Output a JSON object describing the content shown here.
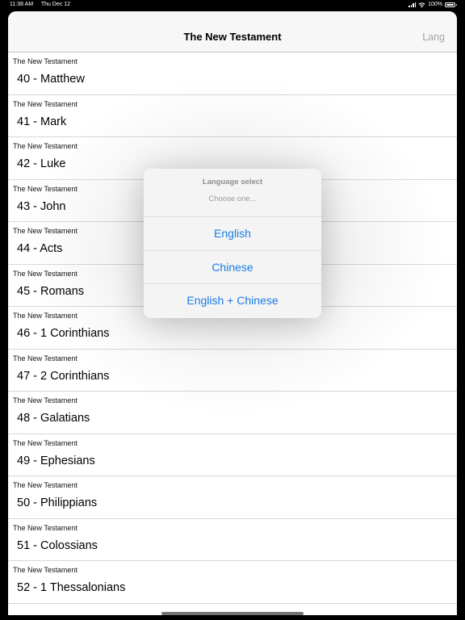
{
  "status_bar": {
    "time": "11:38 AM",
    "date": "Thu Dec 12",
    "battery_percent": "100%",
    "battery_level": 1.0
  },
  "nav": {
    "title": "The New Testament",
    "lang_button": "Lang"
  },
  "books": [
    {
      "subtitle": "The New Testament",
      "title": "40 - Matthew"
    },
    {
      "subtitle": "The New Testament",
      "title": "41 - Mark"
    },
    {
      "subtitle": "The New Testament",
      "title": "42 - Luke"
    },
    {
      "subtitle": "The New Testament",
      "title": "43 - John"
    },
    {
      "subtitle": "The New Testament",
      "title": "44 - Acts"
    },
    {
      "subtitle": "The New Testament",
      "title": "45 - Romans"
    },
    {
      "subtitle": "The New Testament",
      "title": "46 - 1 Corinthians"
    },
    {
      "subtitle": "The New Testament",
      "title": "47 - 2 Corinthians"
    },
    {
      "subtitle": "The New Testament",
      "title": "48 - Galatians"
    },
    {
      "subtitle": "The New Testament",
      "title": "49 - Ephesians"
    },
    {
      "subtitle": "The New Testament",
      "title": "50 - Philippians"
    },
    {
      "subtitle": "The New Testament",
      "title": "51 - Colossians"
    },
    {
      "subtitle": "The New Testament",
      "title": "52 - 1 Thessalonians"
    }
  ],
  "popover": {
    "title": "Language select",
    "message": "Choose one...",
    "options": [
      "English",
      "Chinese",
      "English + Chinese"
    ]
  },
  "colors": {
    "accent": "#1a7ce6",
    "nav_background": "#f7f7f7",
    "lang_disabled": "#a5a5aa"
  },
  "icons": {
    "signal": "signal-icon",
    "wifi": "wifi-icon",
    "battery": "battery-icon"
  }
}
